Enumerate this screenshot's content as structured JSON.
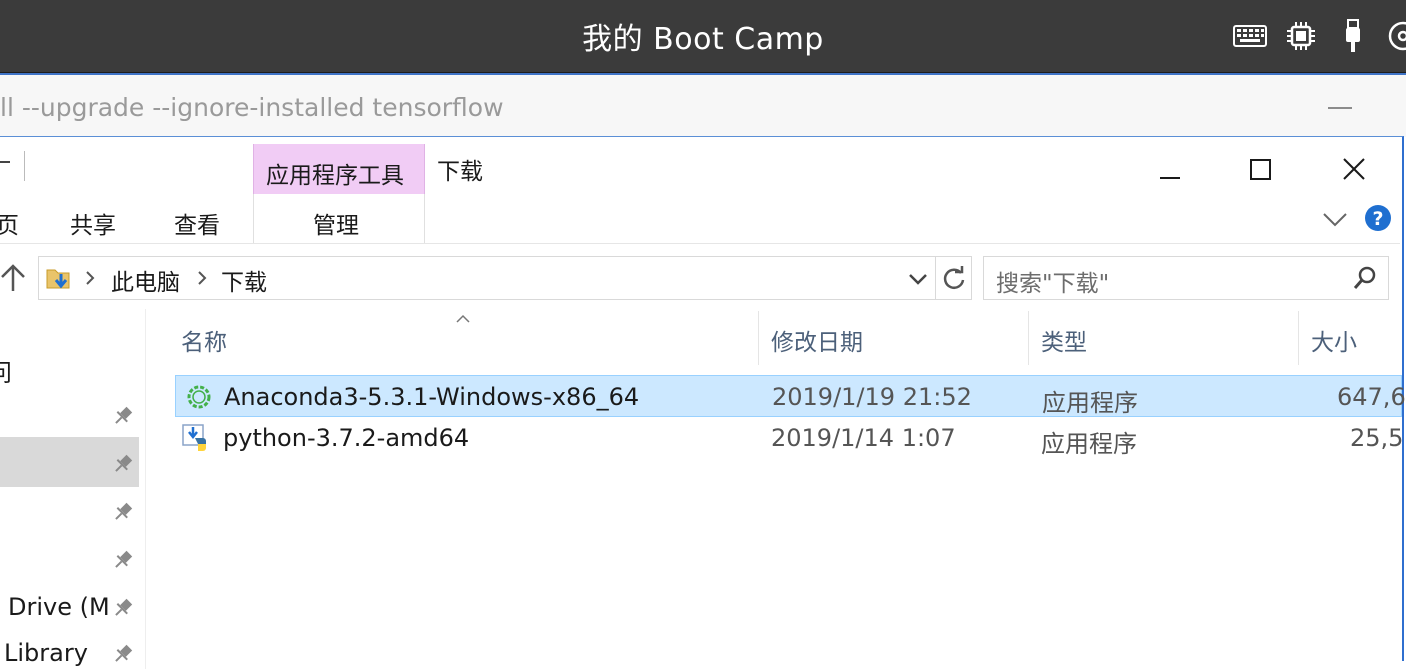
{
  "host": {
    "title": "我的 Boot Camp",
    "icons": [
      "keyboard-icon",
      "chip-icon",
      "usb-icon",
      "disc-icon"
    ]
  },
  "background_window": {
    "command_text": "ll --upgrade --ignore-installed tensorflow"
  },
  "explorer": {
    "quick_access_partial": "​",
    "tabs": {
      "home_partial": "页",
      "share": "共享",
      "view": "查看",
      "app_tools": "应用程序工具",
      "manage": "管理"
    },
    "window_title": "下载",
    "breadcrumb": [
      "此电脑",
      "下载"
    ],
    "search_placeholder": "搜索\"下载\"",
    "columns": {
      "name": "名称",
      "date": "修改日期",
      "type": "类型",
      "size": "大小"
    },
    "files": [
      {
        "name": "Anaconda3-5.3.1-Windows-x86_64",
        "date": "2019/1/19 21:52",
        "type": "应用程序",
        "size": "647,6",
        "icon": "anaconda-icon"
      },
      {
        "name": "python-3.7.2-amd64",
        "date": "2019/1/14 1:07",
        "type": "应用程序",
        "size": "25,5",
        "icon": "python-installer-icon"
      }
    ],
    "nav_items": {
      "partial_1": "问",
      "drive": "Drive (M",
      "library": "Library"
    }
  }
}
